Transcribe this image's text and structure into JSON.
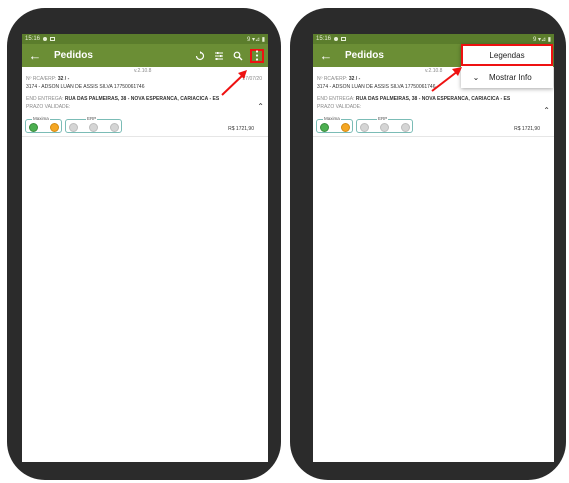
{
  "status_bar": {
    "time": "15:16",
    "icons_right": "9 ▾⊿ ▮"
  },
  "app_bar": {
    "title": "Pedidos",
    "back_icon": "arrow-back-icon",
    "action_icons": [
      "sync-icon",
      "filter-icon",
      "search-icon",
      "more-vert-icon"
    ]
  },
  "order": {
    "version": "v.2.10.8",
    "number_label": "Nº RCA/ERP:",
    "number_value": "32 / -",
    "client": "3174 - ADSON LUAN DE ASSIS SILVA 17750061746",
    "delivery_label": "END ENTREGA:",
    "delivery_value": "RUA DAS PALMEIRAS, 38 - NOVA ESPERANCA, CARIACICA - ES",
    "validity_label": "PRAZO VALIDADE:",
    "date": "27/07/20",
    "group1_label": "Maxima",
    "group2_label": "ERP",
    "price": "R$ 1721,90"
  },
  "menu": {
    "items": [
      "Legendas",
      "Mostrar Info"
    ]
  },
  "colors": {
    "app_bar": "#6b8e35",
    "status_bar": "#5b7d2c",
    "highlight": "#ee1111",
    "accent_green": "#4caf50",
    "accent_orange": "#f5a623"
  }
}
